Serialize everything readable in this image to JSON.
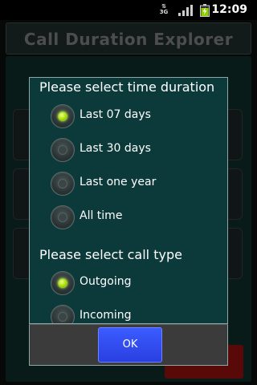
{
  "status_bar": {
    "network": "3G",
    "time": "12:09",
    "icons": [
      "network-3g-icon",
      "signal-icon",
      "battery-charging-icon"
    ]
  },
  "app": {
    "title": "Call Duration Explorer"
  },
  "dialog": {
    "duration_section": {
      "title": "Please select time duration",
      "options": [
        {
          "label": "Last 07 days",
          "checked": true
        },
        {
          "label": "Last 30 days",
          "checked": false
        },
        {
          "label": "Last one year",
          "checked": false
        },
        {
          "label": "All time",
          "checked": false
        }
      ]
    },
    "call_type_section": {
      "title": "Please select call type",
      "options": [
        {
          "label": "Outgoing",
          "checked": true
        },
        {
          "label": "Incoming",
          "checked": false
        }
      ]
    },
    "ok_label": "OK"
  },
  "colors": {
    "dialog_bg": "#0c3a3a",
    "radio_checked": "#b2e000",
    "ok_button": "#3b5cff",
    "background_red": "#8a0e0e"
  }
}
